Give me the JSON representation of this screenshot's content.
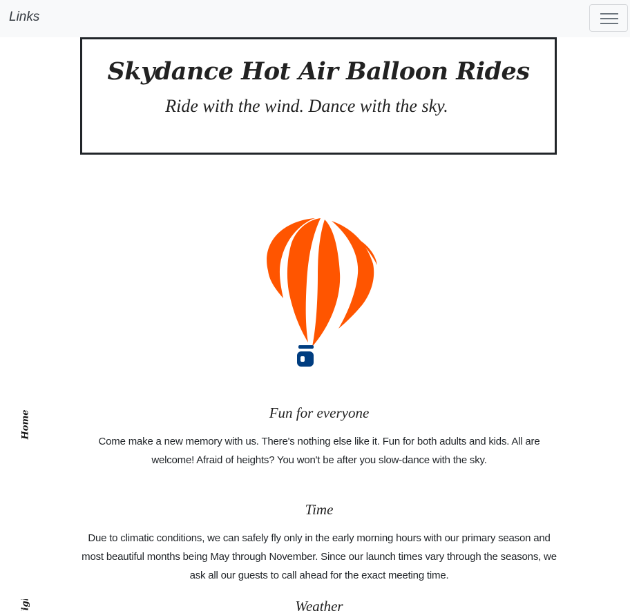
{
  "navbar": {
    "brand": "Links",
    "toggler_icon": "hamburger-menu-icon"
  },
  "header": {
    "title": "Skydance Hot Air Balloon Rides",
    "tagline": "Ride with the wind. Dance with the sky."
  },
  "hero": {
    "image": "hot-air-balloon-illustration",
    "colors": {
      "envelope": "#ff5500",
      "basket": "#003d80"
    }
  },
  "side_nav": {
    "items": [
      {
        "label": "Home"
      },
      {
        "label": "Flights"
      }
    ]
  },
  "sections": [
    {
      "heading": "Fun for everyone",
      "body": "Come make a new memory with us. There's nothing else like it. Fun for both adults and kids. All are welcome! Afraid of heights? You won't be after you slow-dance with the sky."
    },
    {
      "heading": "Time",
      "body": "Due to climatic conditions, we can safely fly only in the early morning hours with our primary season and most beautiful months being May through November. Since our launch times vary through the seasons, we ask all our guests to call ahead for the exact meeting time."
    },
    {
      "heading": "Weather",
      "body": ""
    }
  ]
}
